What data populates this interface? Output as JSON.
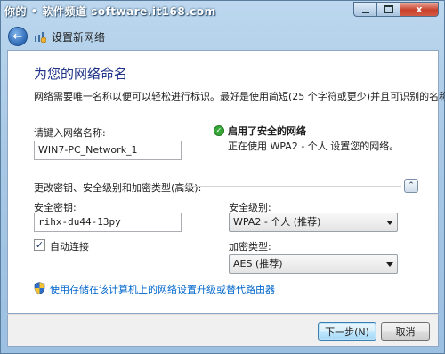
{
  "watermark": "你的 • 软件频道 software.it168.com",
  "window": {
    "nav_title": "设置新网络",
    "caption_close_glyph": "x",
    "back_glyph": "←"
  },
  "main": {
    "heading": "为您的网络命名",
    "description": "网络需要唯一名称以便可以轻松进行标识。最好是使用简短(25 个字符或更少)并且可识别的名称。",
    "network_name": {
      "label": "请键入网络名称:",
      "value": "WIN7-PC_Network_1"
    },
    "security_status": {
      "title": "启用了安全的网络",
      "subtitle": "正在使用 WPA2 - 个人 设置您的网络。"
    },
    "advanced": {
      "label": "更改密钥、安全级别和加密类型(高级):",
      "collapse_glyph": "⌃"
    },
    "security_key": {
      "label": "安全密钥:",
      "value": "rihx-du44-13py"
    },
    "security_level": {
      "label": "安全级别:",
      "value": "WPA2 - 个人 (推荐)"
    },
    "encryption": {
      "label": "加密类型:",
      "value": "AES (推荐)"
    },
    "auto_connect": {
      "label": "自动连接",
      "checked": true,
      "check_glyph": "✓"
    },
    "link_text": "使用存储在该计算机上的网络设置升级或替代路由器"
  },
  "footer": {
    "next_label": "下一步(N)",
    "cancel_label": "取消"
  },
  "colors": {
    "heading": "#1e3287",
    "link": "#0066cc",
    "shield_check": "#37a838"
  }
}
